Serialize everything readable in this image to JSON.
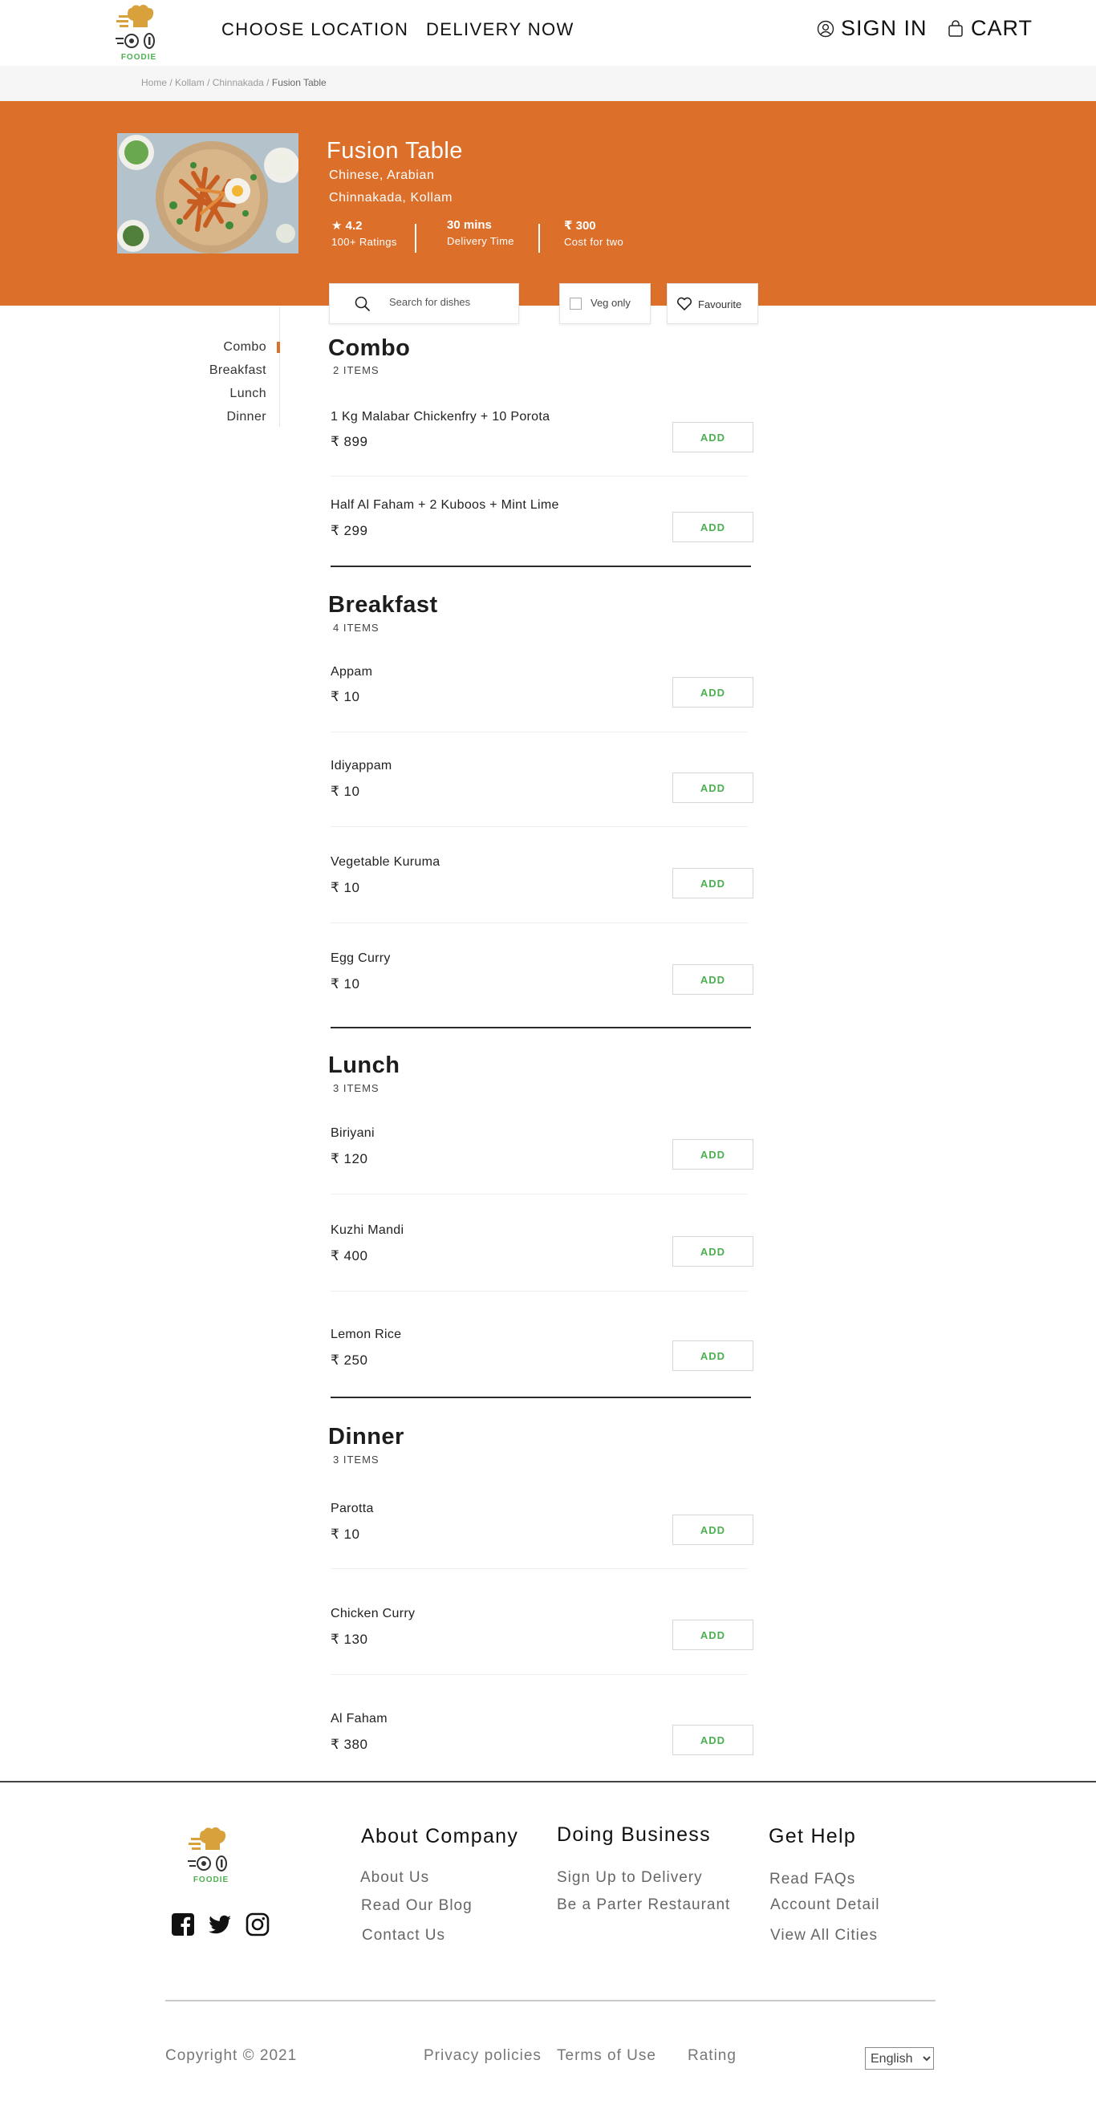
{
  "brand": {
    "logo_text": "FOODIE"
  },
  "header": {
    "nav": [
      "CHOOSE LOCATION",
      "DELIVERY NOW"
    ],
    "sign_in": "SIGN IN",
    "cart": "CART"
  },
  "breadcrumb": {
    "home": "Home",
    "city": "Kollam",
    "area": "Chinnakada",
    "current": "Fusion Table",
    "separator": "/"
  },
  "restaurant": {
    "name": "Fusion Table",
    "cuisines": "Chinese, Arabian",
    "location": "Chinnakada, Kollam",
    "rating_value": "4.2",
    "rating_label": "100+ Ratings",
    "delivery_value": "30 mins",
    "delivery_label": "Delivery Time",
    "cost_value": "300",
    "cost_label": "Cost for two",
    "banner_color": "#dc702b"
  },
  "filters": {
    "search_placeholder": "Search for dishes",
    "veg_only_label": "Veg only",
    "veg_only_checked": false,
    "favourite_label": "Favourite"
  },
  "categories": [
    "Combo",
    "Breakfast",
    "Lunch",
    "Dinner"
  ],
  "active_category": "Combo",
  "currency_symbol": "₹",
  "add_label": "ADD",
  "sections": [
    {
      "title": "Combo",
      "count": "2 ITEMS",
      "items": [
        {
          "name": "1 Kg Malabar Chickenfry + 10 Porota",
          "price": "₹ 899"
        },
        {
          "name": "Half Al Faham + 2 Kuboos + Mint Lime",
          "price": "₹ 299"
        }
      ]
    },
    {
      "title": "Breakfast",
      "count": "4 ITEMS",
      "items": [
        {
          "name": "Appam",
          "price": "₹ 10"
        },
        {
          "name": "Idiyappam",
          "price": "₹ 10"
        },
        {
          "name": "Vegetable Kuruma",
          "price": "₹ 10"
        },
        {
          "name": "Egg Curry",
          "price": "₹ 10"
        }
      ]
    },
    {
      "title": "Lunch",
      "count": "3 ITEMS",
      "items": [
        {
          "name": "Biriyani",
          "price": "₹ 120"
        },
        {
          "name": "Kuzhi Mandi",
          "price": "₹ 400"
        },
        {
          "name": "Lemon Rice",
          "price": "₹ 250"
        }
      ]
    },
    {
      "title": "Dinner",
      "count": "3 ITEMS",
      "items": [
        {
          "name": "Parotta",
          "price": "₹ 10"
        },
        {
          "name": "Chicken Curry",
          "price": "₹ 130"
        },
        {
          "name": "Al Faham",
          "price": "₹ 380"
        }
      ]
    }
  ],
  "footer": {
    "about": {
      "heading": "About Company",
      "links": [
        "About Us",
        "Read Our Blog",
        "Contact Us"
      ]
    },
    "business": {
      "heading": "Doing Business",
      "links": [
        "Sign Up to Delivery",
        "Be a Parter Restaurant"
      ]
    },
    "help": {
      "heading": "Get Help",
      "links": [
        "Read FAQs",
        "Account Detail",
        "View All Cities"
      ]
    },
    "copyright": "Copyright © 2021",
    "bottom_links": [
      "Privacy policies",
      "Terms of Use",
      "Rating"
    ],
    "language": "English",
    "social_icons": [
      "facebook-icon",
      "twitter-icon",
      "instagram-icon"
    ]
  }
}
